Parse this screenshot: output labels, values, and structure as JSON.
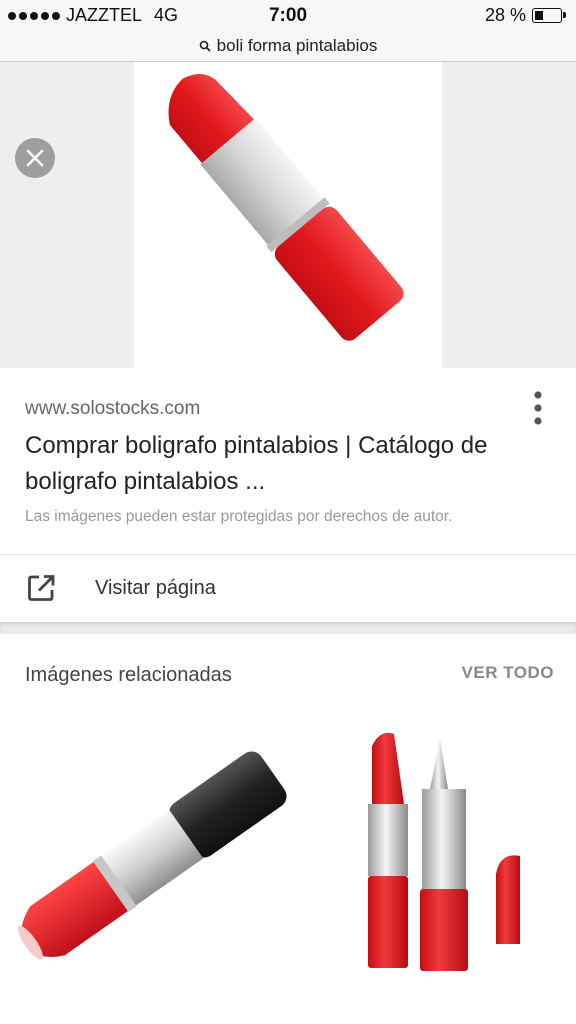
{
  "status_bar": {
    "carrier": "JAZZTEL",
    "network": "4G",
    "time": "7:00",
    "battery_percent": "28 %",
    "battery_level": 0.28
  },
  "address_bar": {
    "query": "boli forma pintalabios",
    "icon": "search-icon"
  },
  "viewer": {
    "close_icon": "close-icon"
  },
  "result": {
    "domain": "www.solostocks.com",
    "title": "Comprar boligrafo pintalabios | Catálogo de boligrafo pintalabios ...",
    "copyright_notice": "Las imágenes pueden estar protegidas por derechos de autor.",
    "menu_icon": "more-vert-icon"
  },
  "visit": {
    "label": "Visitar página",
    "icon": "open-in-new-icon"
  },
  "related": {
    "heading": "Imágenes relacionadas",
    "see_all": "VER TODO"
  },
  "colors": {
    "lipstick_red": "#e8282b",
    "silver": "#d9d9d9",
    "black_cap": "#2a2a2a",
    "muted_text": "#999999"
  }
}
